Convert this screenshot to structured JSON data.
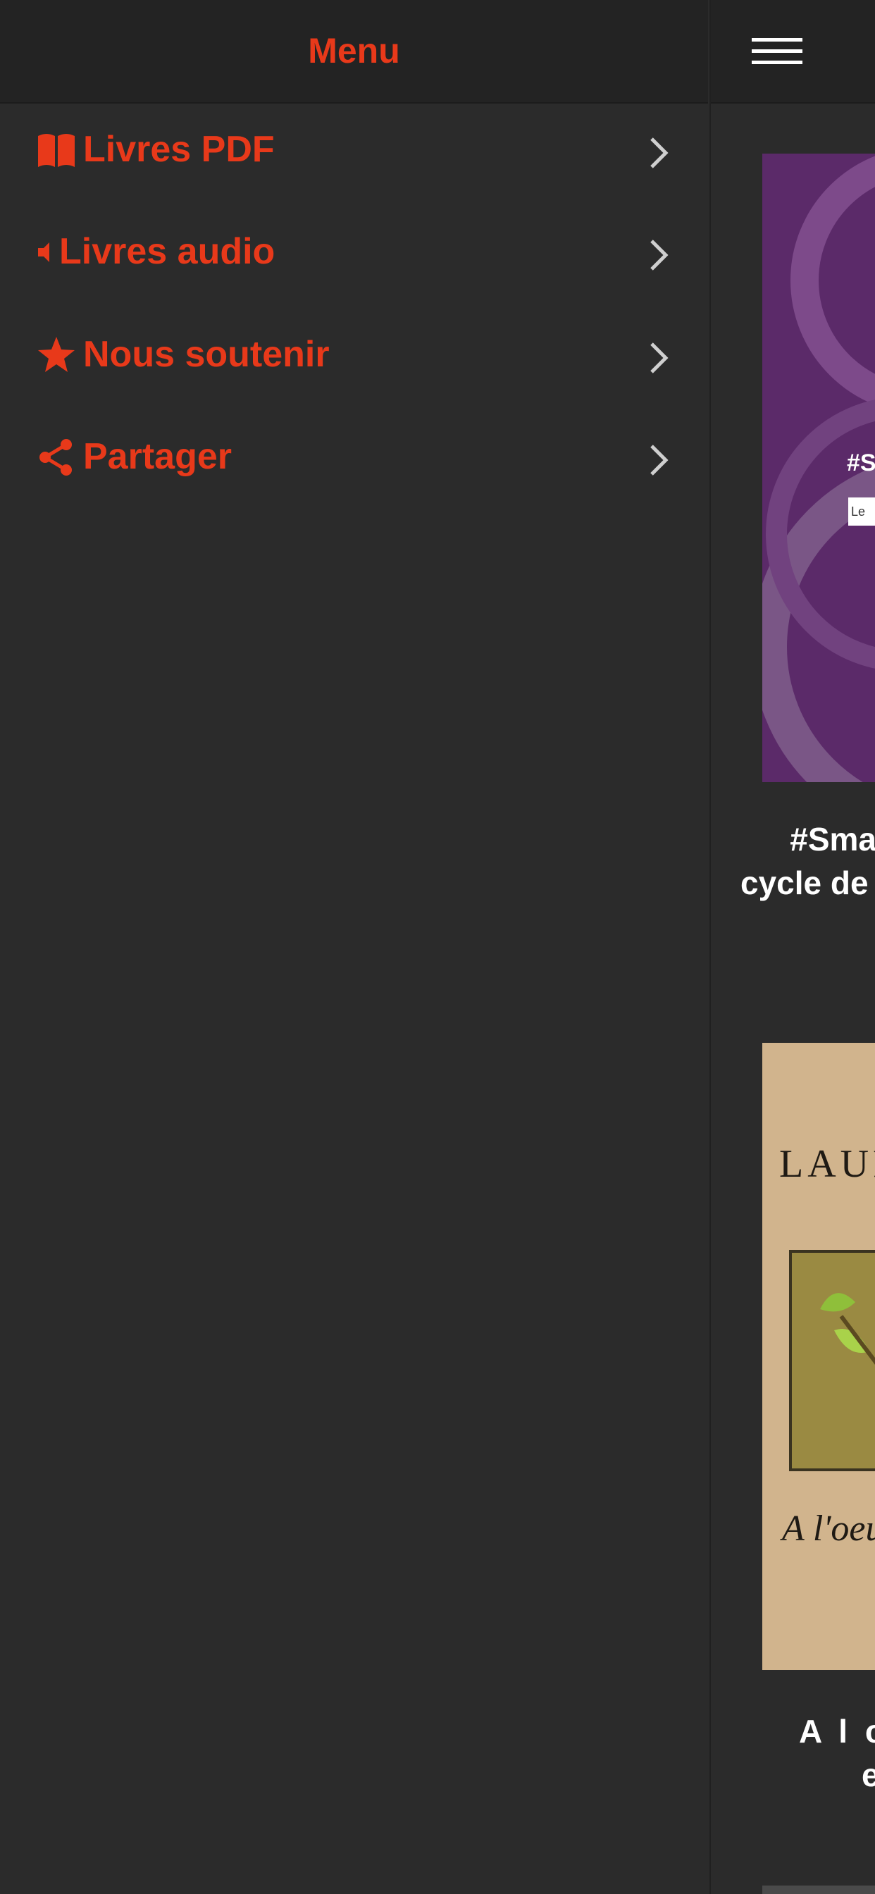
{
  "drawer": {
    "title": "Menu",
    "items": [
      {
        "label": "Livres PDF",
        "icon": "book-open-icon"
      },
      {
        "label": "Livres audio",
        "icon": "volume-icon"
      },
      {
        "label": "Nous soutenir",
        "icon": "star-icon"
      },
      {
        "label": "Partager",
        "icon": "share-icon"
      }
    ]
  },
  "colors": {
    "accent": "#e8391a",
    "background": "#2b2b2b",
    "header": "#232323",
    "chevron": "#cfcfcf"
  },
  "books": [
    {
      "cover_label": "#S",
      "cover_tag": "Le",
      "title_line1": "#Sma",
      "title_line2": "cycle de"
    },
    {
      "cover_author": "LAUR",
      "cover_subtitle": "A l'oeuv",
      "title_line1": "A l oe",
      "title_line2": "e"
    }
  ]
}
